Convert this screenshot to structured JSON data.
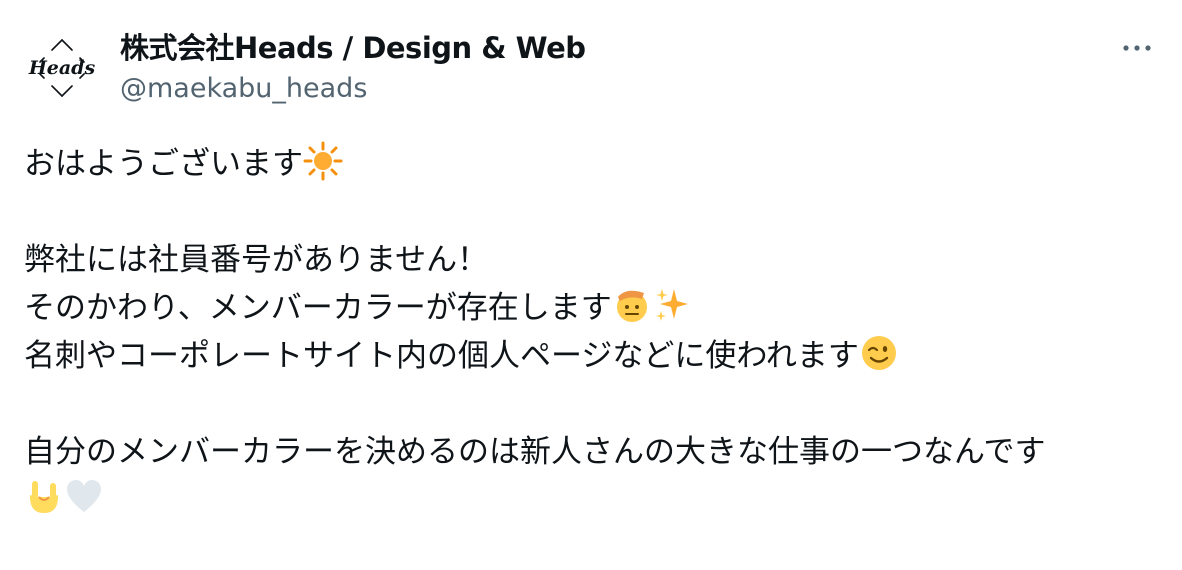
{
  "author": {
    "display_name": "株式会社Heads / Design & Web",
    "handle": "@maekabu_heads",
    "avatar_logo_text": "Heads"
  },
  "more_menu": {
    "icon": "more-horizontal-icon"
  },
  "tweet": {
    "lines": [
      {
        "text": "おはようございます",
        "emojis": [
          "sun-emoji"
        ]
      },
      {
        "text": "",
        "emojis": []
      },
      {
        "text": "弊社には社員番号がありません！",
        "emojis": []
      },
      {
        "text": "そのかわり、メンバーカラーが存在します",
        "emojis": [
          "saluting-face-emoji",
          "sparkles-emoji"
        ]
      },
      {
        "text": "名刺やコーポレートサイト内の個人ページなどに使われます",
        "emojis": [
          "winking-face-emoji"
        ]
      },
      {
        "text": "",
        "emojis": []
      },
      {
        "text": "自分のメンバーカラーを決めるのは新人さんの大きな仕事の一つなんです",
        "emojis": []
      },
      {
        "text": "",
        "emojis": [
          "sign-of-the-horns-emoji",
          "white-heart-emoji"
        ]
      }
    ]
  },
  "colors": {
    "text": "#0f1419",
    "secondary_text": "#536471",
    "sun": "#f4900c",
    "sparkle": "#ffac33",
    "face": "#ffcc4d",
    "hand": "#ffdc5d",
    "white_heart": "#e1e8ed"
  }
}
